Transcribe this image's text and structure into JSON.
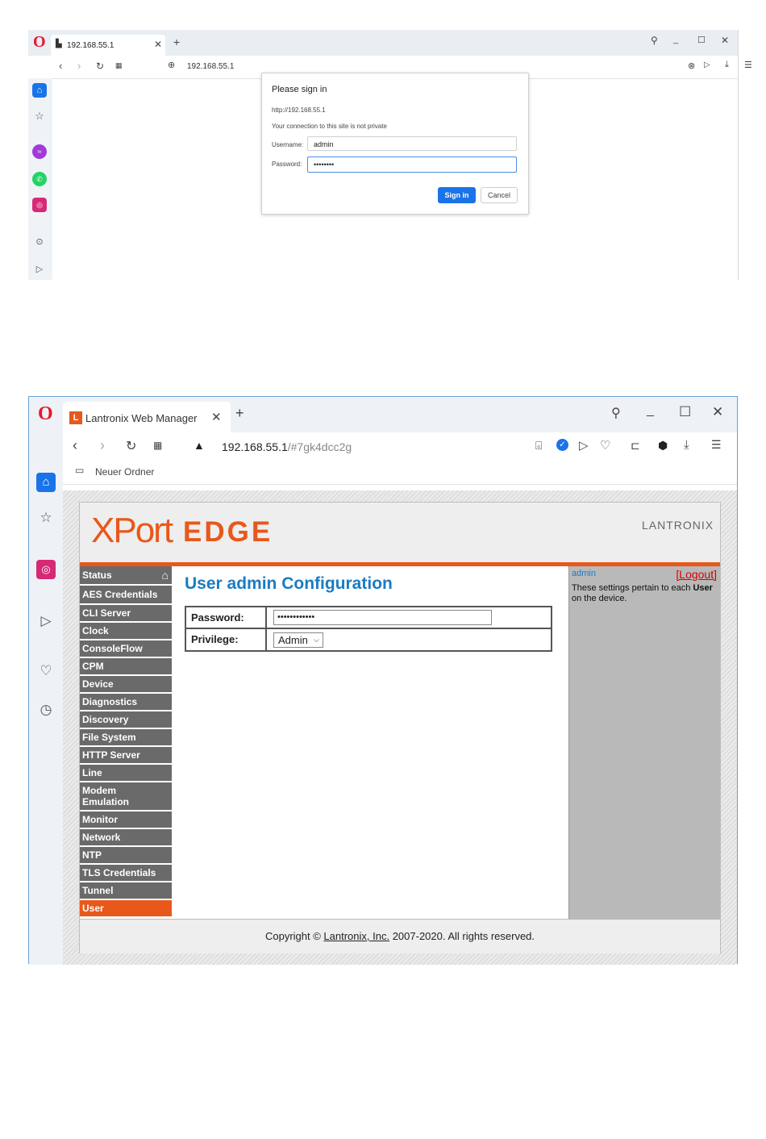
{
  "window1": {
    "tab_title": "192.168.55.1",
    "address": "192.168.55.1",
    "dialog": {
      "title": "Please sign in",
      "url": "http://192.168.55.1",
      "notice": "Your connection to this site is not private",
      "username_label": "Username:",
      "username_value": "admin",
      "password_label": "Password:",
      "password_value": "••••••••",
      "sign_in_label": "Sign in",
      "cancel_label": "Cancel"
    }
  },
  "window2": {
    "tab_title": "Lantronix Web Manager",
    "address_host": "192.168.55.1",
    "address_hash": "/#7gk4dcc2g",
    "bookmark_folder": "Neuer Ordner",
    "logo_xport": "XPort",
    "logo_edge": "EDGE",
    "logo_brand": "LANTRONIX",
    "nav_items": [
      "Status",
      "AES Credentials",
      "CLI Server",
      "Clock",
      "ConsoleFlow",
      "CPM",
      "Device",
      "Diagnostics",
      "Discovery",
      "File System",
      "HTTP Server",
      "Line",
      "Modem Emulation",
      "Monitor",
      "Network",
      "NTP",
      "TLS Credentials",
      "Tunnel",
      "User"
    ],
    "active_nav": "User",
    "page_title": "User admin Configuration",
    "password_label": "Password:",
    "password_value": "••••••••••••",
    "privilege_label": "Privilege:",
    "privilege_value": "Admin",
    "right_user": "admin",
    "logout_label": "[Logout]",
    "help_text_pre": "These settings pertain to each ",
    "help_text_bold": "User",
    "help_text_post": " on the device.",
    "footer_pre": "Copyright © ",
    "footer_link": "Lantronix, Inc.",
    "footer_post": " 2007-2020. All rights reserved."
  },
  "colors": {
    "opera_red": "#e8172c",
    "lantronix_orange": "#e8581a",
    "title_blue": "#1a7cc1",
    "nav_gray": "#6a6a6a",
    "sign_in_blue": "#1a73e8"
  }
}
